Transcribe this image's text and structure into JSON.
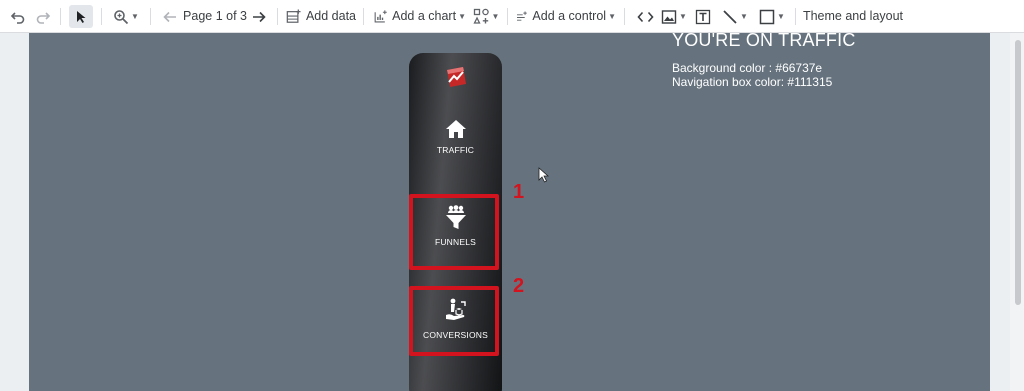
{
  "toolbar": {
    "page_indicator": "Page 1 of 3",
    "add_data": "Add data",
    "add_chart": "Add a chart",
    "add_control": "Add a control",
    "theme_layout": "Theme and layout",
    "icons": [
      "undo-icon",
      "redo-icon",
      "select-icon",
      "zoom-icon",
      "prev-page-icon",
      "next-page-icon",
      "add-data-icon",
      "add-chart-icon",
      "community-viz-icon",
      "add-control-icon",
      "embed-icon",
      "image-icon",
      "text-icon",
      "line-icon",
      "shape-icon"
    ]
  },
  "report": {
    "background_color": "#66737e",
    "nav_box_color": "#111315",
    "heading": "YOU'RE ON TRAFFIC",
    "line1": "Background color : #66737e",
    "line2": "Navigation box color: #111315"
  },
  "nav": {
    "items": [
      {
        "label": "TRAFFIC",
        "icon": "home-icon"
      },
      {
        "label": "FUNNELS",
        "icon": "funnel-icon"
      },
      {
        "label": "CONVERSIONS",
        "icon": "conversion-icon"
      }
    ]
  },
  "annotations": {
    "marker1": "1",
    "marker2": "2",
    "highlight_color": "#d3131d"
  }
}
